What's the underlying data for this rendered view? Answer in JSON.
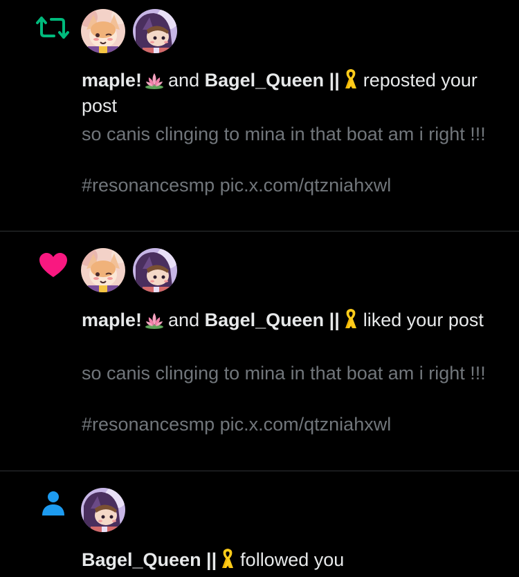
{
  "colors": {
    "background": "#000000",
    "text_primary": "#e7e9ea",
    "text_secondary": "#71767b",
    "divider": "#2f3336",
    "repost": "#00ba7c",
    "like": "#f91880",
    "follow": "#1d9bf0"
  },
  "notifications": [
    {
      "type_icon": "repost-icon",
      "avatars": [
        "maple-avatar",
        "bagel-queen-avatar"
      ],
      "user1": "maple!",
      "user1_emoji": "lotus-emoji",
      "connector": "and",
      "user2": "Bagel_Queen ||",
      "user2_emoji": "ribbon-emoji",
      "action": "reposted your post",
      "post_text": "so canis clinging to mina in that boat am i right !!!\n\n#resonancesmp pic.x.com/qtzniahxwl"
    },
    {
      "type_icon": "heart-icon",
      "avatars": [
        "maple-avatar",
        "bagel-queen-avatar"
      ],
      "user1": "maple!",
      "user1_emoji": "lotus-emoji",
      "connector": "and",
      "user2": "Bagel_Queen ||",
      "user2_emoji": "ribbon-emoji",
      "action": "liked your post",
      "post_text": "so canis clinging to mina in that boat am i right !!!\n\n#resonancesmp pic.x.com/qtzniahxwl"
    },
    {
      "type_icon": "person-icon",
      "avatars": [
        "bagel-queen-avatar"
      ],
      "user1": "Bagel_Queen ||",
      "user1_emoji": "ribbon-emoji",
      "action": "followed you"
    }
  ]
}
